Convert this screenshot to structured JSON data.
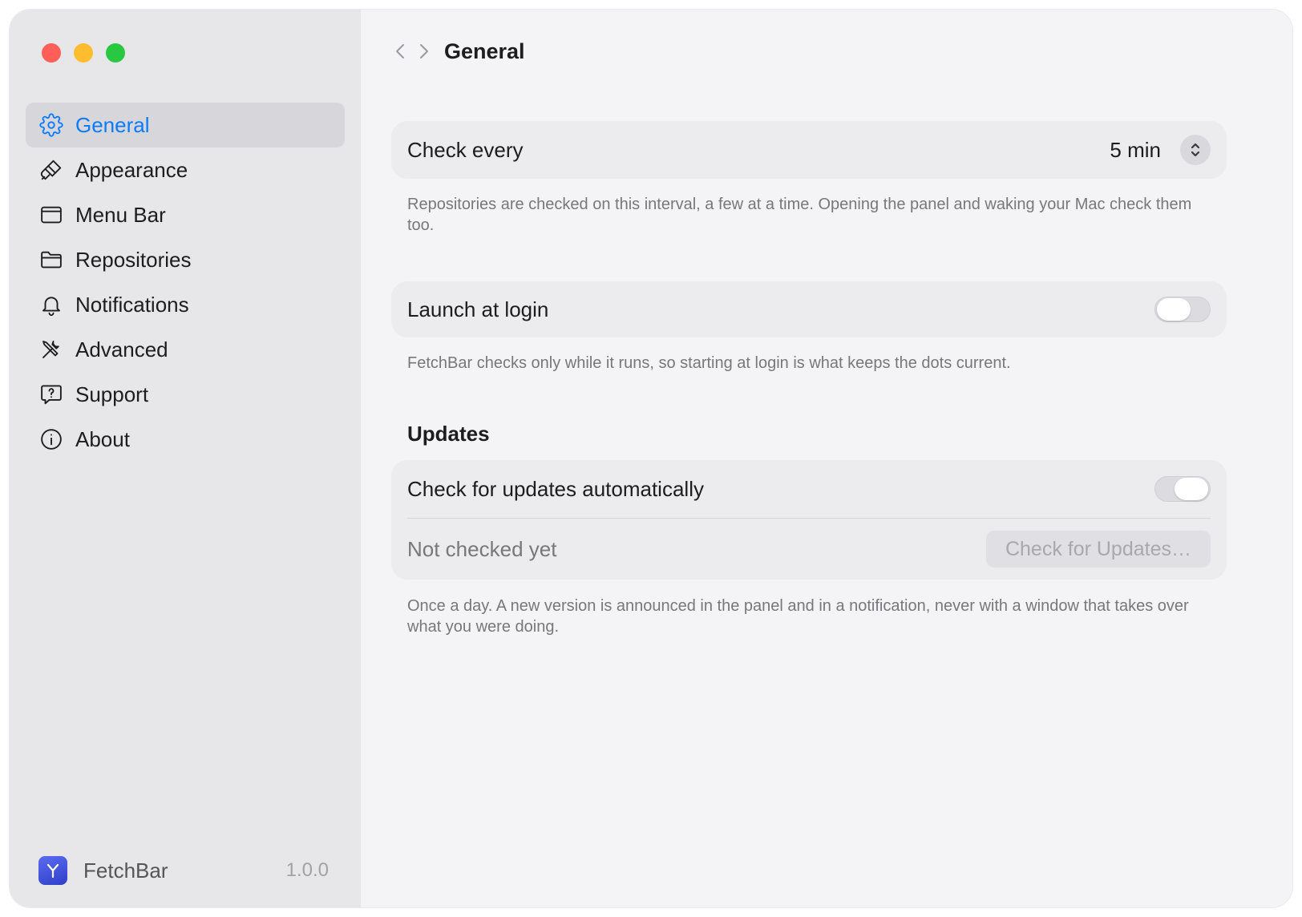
{
  "window": {
    "title": "General"
  },
  "sidebar": {
    "items": [
      {
        "label": "General",
        "icon": "gear-icon",
        "active": true
      },
      {
        "label": "Appearance",
        "icon": "paintbrush-icon"
      },
      {
        "label": "Menu Bar",
        "icon": "window-icon"
      },
      {
        "label": "Repositories",
        "icon": "folder-icon"
      },
      {
        "label": "Notifications",
        "icon": "bell-icon"
      },
      {
        "label": "Advanced",
        "icon": "tools-icon"
      },
      {
        "label": "Support",
        "icon": "help-bubble-icon"
      },
      {
        "label": "About",
        "icon": "info-icon"
      }
    ],
    "footer": {
      "app_name": "FetchBar",
      "version": "1.0.0"
    }
  },
  "general": {
    "check_every": {
      "label": "Check every",
      "value": "5 min",
      "note": "Repositories are checked on this interval, a few at a time. Opening the panel and waking your Mac check them too."
    },
    "launch_at_login": {
      "label": "Launch at login",
      "enabled": false,
      "note": "FetchBar checks only while it runs, so starting at login is what keeps the dots current."
    },
    "updates": {
      "section_title": "Updates",
      "auto_label": "Check for updates automatically",
      "auto_enabled": true,
      "status": "Not checked yet",
      "button_label": "Check for Updates…",
      "note": "Once a day. A new version is announced in the panel and in a notification, never with a window that takes over what you were doing."
    }
  },
  "colors": {
    "accent": "#0a7aff",
    "sidebar_bg": "#e7e7ea",
    "content_bg": "#f4f4f6",
    "close": "#ff5f57",
    "minimize": "#febc2e",
    "zoom": "#28c840"
  }
}
